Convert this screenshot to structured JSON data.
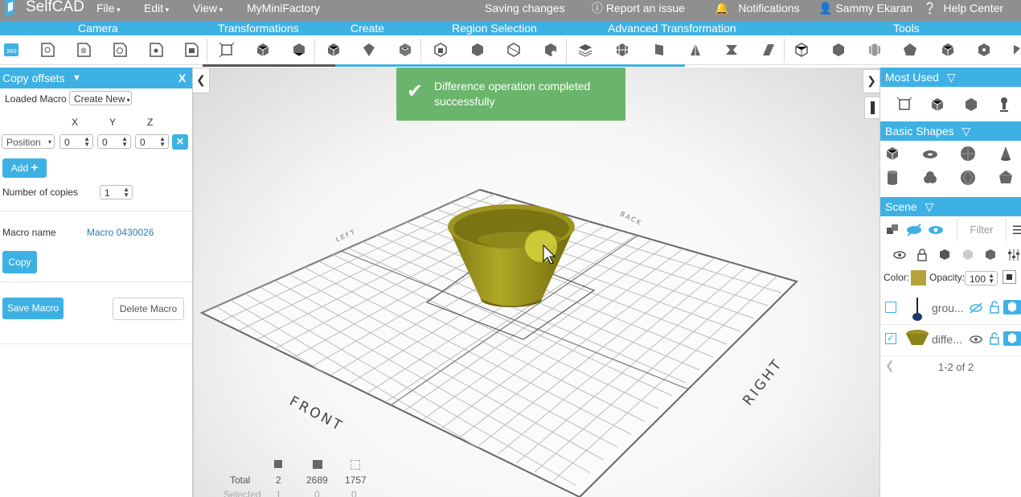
{
  "topbar": {
    "logo": "SelfCAD",
    "menus": [
      "File",
      "Edit",
      "View"
    ],
    "link": "MyMiniFactory",
    "saving": "Saving changes",
    "report": "Report an issue",
    "notifications": "Notifications",
    "user": "Sammy Ekaran",
    "help": "Help Center"
  },
  "categories": [
    "Camera",
    "Transformations",
    "Create",
    "Region Selection",
    "Advanced Transformation",
    "Tools"
  ],
  "left_panel": {
    "title": "Copy offsets",
    "close": "X",
    "loaded_macro_label": "Loaded Macro",
    "loaded_macro_value": "Create New",
    "axes": [
      "X",
      "Y",
      "Z"
    ],
    "mode": "Position",
    "x": "0",
    "y": "0",
    "z": "0",
    "add_label": "Add",
    "copies_label": "Number of copies",
    "copies_value": "1",
    "macro_name_label": "Macro name",
    "macro_name_value": "Macro 0430026",
    "copy_label": "Copy",
    "save_macro_label": "Save Macro",
    "delete_macro_label": "Delete Macro"
  },
  "toast": {
    "message": "Difference operation completed successfully"
  },
  "viewport": {
    "front": "FRONT",
    "right": "RIGHT",
    "left": "LEFT",
    "back": "BACK",
    "stats": {
      "total_label": "Total",
      "selected_label": "Selected",
      "objects": "2",
      "faces": "2689",
      "vertices": "1757",
      "sel_objects": "1",
      "sel_faces": "0",
      "sel_vertices": "0"
    },
    "model_color": "#a39c22"
  },
  "right_panel": {
    "most_used": "Most Used",
    "basic_shapes": "Basic Shapes",
    "scene": "Scene",
    "filter_placeholder": "Filter",
    "color_label": "Color:",
    "color_value": "#b6a23a",
    "opacity_label": "Opacity:",
    "opacity_value": "100",
    "items": [
      {
        "name": "grou...",
        "checked": false
      },
      {
        "name": "diffe...",
        "checked": true
      }
    ],
    "pagination": "1-2 of 2"
  },
  "colors": {
    "accent": "#3eb1e4",
    "topbar": "#8f8f8f",
    "toast": "#6ab56b"
  }
}
